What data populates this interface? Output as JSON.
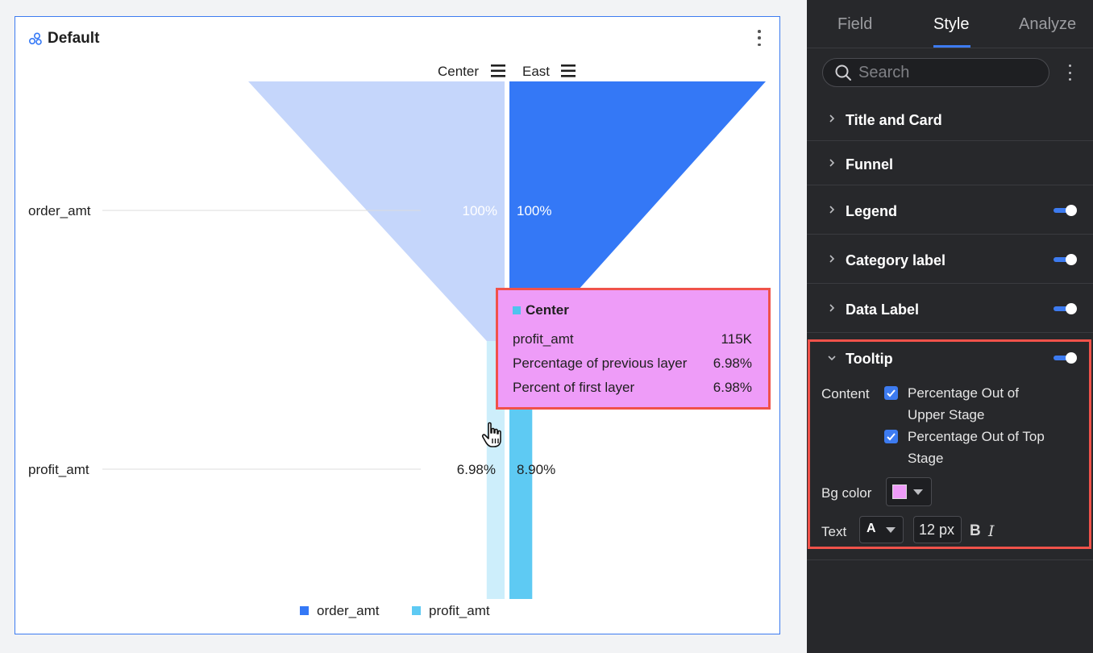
{
  "card": {
    "title": "Default",
    "icon": "link-chart-icon",
    "more_icon": "more-vertical-icon"
  },
  "chart_data": {
    "type": "funnel",
    "groups": [
      "Center",
      "East"
    ],
    "stages": [
      "order_amt",
      "profit_amt"
    ],
    "series": [
      {
        "name": "Center",
        "percent_of_first_layer": [
          100,
          6.98
        ],
        "labels": [
          "100%",
          "6.98%"
        ]
      },
      {
        "name": "East",
        "percent_of_first_layer": [
          100,
          8.9
        ],
        "labels": [
          "100%",
          "8.90%"
        ]
      }
    ],
    "legend": {
      "placement": "bottom",
      "items": [
        {
          "name": "order_amt",
          "color": "#3478f6"
        },
        {
          "name": "profit_amt",
          "color": "#5ecaf3"
        }
      ]
    },
    "colors": {
      "center_order": "#c5d6fb",
      "center_profit": "#cdeefb",
      "east_order": "#3478f6",
      "east_profit": "#5ecaf3",
      "divider_line": "#dcdcdc"
    }
  },
  "tooltip": {
    "title": "Center",
    "marker_color": "#4fc3ee",
    "bg_color": "#ee9cf8",
    "rows": [
      {
        "label": "profit_amt",
        "value": "115K"
      },
      {
        "label": "Percentage of previous layer",
        "value": "6.98%"
      },
      {
        "label": "Percent of first layer",
        "value": "6.98%"
      }
    ]
  },
  "panel": {
    "tabs": [
      "Field",
      "Style",
      "Analyze"
    ],
    "active_tab": "Style",
    "search_placeholder": "Search",
    "sections": [
      {
        "label": "Title and Card",
        "toggle": false
      },
      {
        "label": "Funnel",
        "toggle": false
      },
      {
        "label": "Legend",
        "toggle": true
      },
      {
        "label": "Category label",
        "toggle": true
      },
      {
        "label": "Data Label",
        "toggle": true
      },
      {
        "label": "Tooltip",
        "toggle": true,
        "expanded": true
      }
    ],
    "tooltip_settings": {
      "content_label": "Content",
      "options": [
        {
          "line1": "Percentage Out of",
          "line2": "Upper Stage",
          "checked": true
        },
        {
          "line1": "Percentage Out of Top",
          "line2": "Stage",
          "checked": true
        }
      ],
      "bg_color_label": "Bg color",
      "bg_color": "#ee9cf8",
      "text_label": "Text",
      "font_color_glyph": "A",
      "font_size": "12 px",
      "bold_glyph": "B",
      "italic_glyph": "I"
    }
  }
}
